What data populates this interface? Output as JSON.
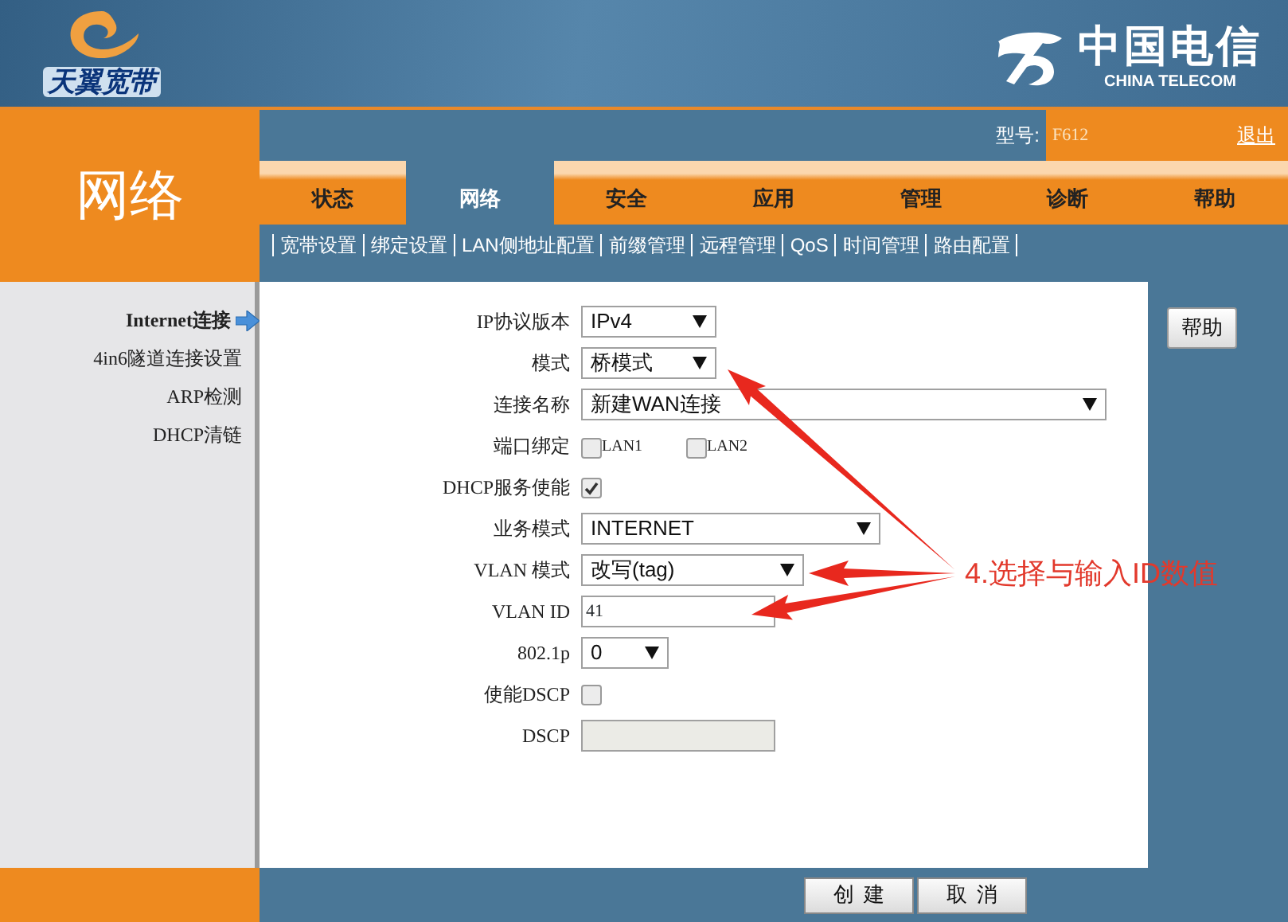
{
  "header": {
    "brand": "天翼宽带",
    "logo_cn": "中国电信",
    "logo_en": "CHINA TELECOM"
  },
  "section_title": "网络",
  "model": {
    "label": "型号:",
    "value": "F612"
  },
  "logout": "退出",
  "tabs": [
    {
      "label": "状态",
      "selected": false
    },
    {
      "label": "网络",
      "selected": true
    },
    {
      "label": "安全",
      "selected": false
    },
    {
      "label": "应用",
      "selected": false
    },
    {
      "label": "管理",
      "selected": false
    },
    {
      "label": "诊断",
      "selected": false
    },
    {
      "label": "帮助",
      "selected": false
    }
  ],
  "subnav": [
    "宽带设置",
    "绑定设置",
    "LAN侧地址配置",
    "前缀管理",
    "远程管理",
    "QoS",
    "时间管理",
    "路由配置"
  ],
  "sidebar": [
    {
      "label": "Internet连接",
      "selected": true
    },
    {
      "label": "4in6隧道连接设置",
      "selected": false
    },
    {
      "label": "ARP检测",
      "selected": false
    },
    {
      "label": "DHCP清链",
      "selected": false
    }
  ],
  "form": [
    {
      "label": "IP协议版本",
      "kind": "select",
      "value": "IPv4"
    },
    {
      "label": "模式",
      "kind": "select",
      "value": "桥模式"
    },
    {
      "label": "连接名称",
      "kind": "select",
      "value": "新建WAN连接"
    },
    {
      "label": "端口绑定",
      "kind": "checkboxes",
      "options": [
        {
          "label": "LAN1",
          "checked": false
        },
        {
          "label": "LAN2",
          "checked": false
        }
      ]
    },
    {
      "label": "DHCP服务使能",
      "kind": "checkbox",
      "checked": true
    },
    {
      "label": "业务模式",
      "kind": "select",
      "value": "INTERNET"
    },
    {
      "label": "VLAN 模式",
      "kind": "select",
      "value": "改写(tag)"
    },
    {
      "label": "VLAN ID",
      "kind": "input",
      "value": "41",
      "disabled": false
    },
    {
      "label": "802.1p",
      "kind": "select",
      "value": "0"
    },
    {
      "label": "使能DSCP",
      "kind": "checkbox",
      "checked": false
    },
    {
      "label": "DSCP",
      "kind": "input",
      "disabled": true
    }
  ],
  "help_button": "帮助",
  "buttons": [
    "创建",
    "取消"
  ],
  "annotation": {
    "text": "4.选择与输入ID数值"
  }
}
